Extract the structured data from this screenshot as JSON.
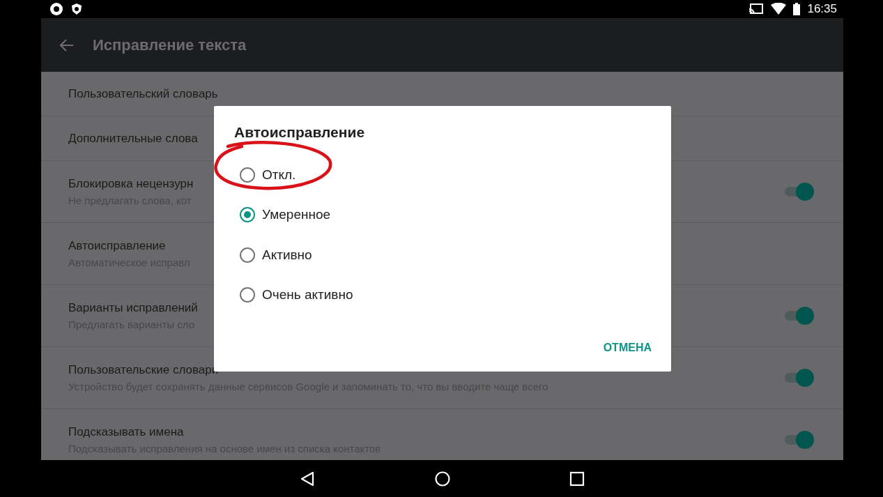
{
  "status_bar": {
    "time": "16:35"
  },
  "app_bar": {
    "title": "Исправление текста"
  },
  "settings": [
    {
      "kind": "plain",
      "title": "Пользовательский словарь"
    },
    {
      "kind": "plain",
      "title": "Дополнительные слова"
    },
    {
      "kind": "toggle",
      "title": "Блокировка нецензурн",
      "subtitle": "Не предлагать слова, кот",
      "on": true
    },
    {
      "kind": "plain",
      "title": "Автоисправление",
      "subtitle": "Автоматическое исправл"
    },
    {
      "kind": "toggle",
      "title": "Варианты исправлений",
      "subtitle": "Предлагать варианты сло",
      "on": true
    },
    {
      "kind": "toggle",
      "title": "Пользовательские словари",
      "subtitle": "Устройство будет сохранять данные сервисов Google и запоминать то, что вы вводите чаще всего",
      "on": true
    },
    {
      "kind": "toggle",
      "title": "Подсказывать имена",
      "subtitle": "Подсказывать исправления на основе имен из списка контактов",
      "on": true
    }
  ],
  "dialog": {
    "title": "Автоисправление",
    "options": [
      {
        "label": "Откл.",
        "selected": false
      },
      {
        "label": "Умеренное",
        "selected": true
      },
      {
        "label": "Активно",
        "selected": false
      },
      {
        "label": "Очень активно",
        "selected": false
      }
    ],
    "cancel": "ОТМЕНА"
  }
}
